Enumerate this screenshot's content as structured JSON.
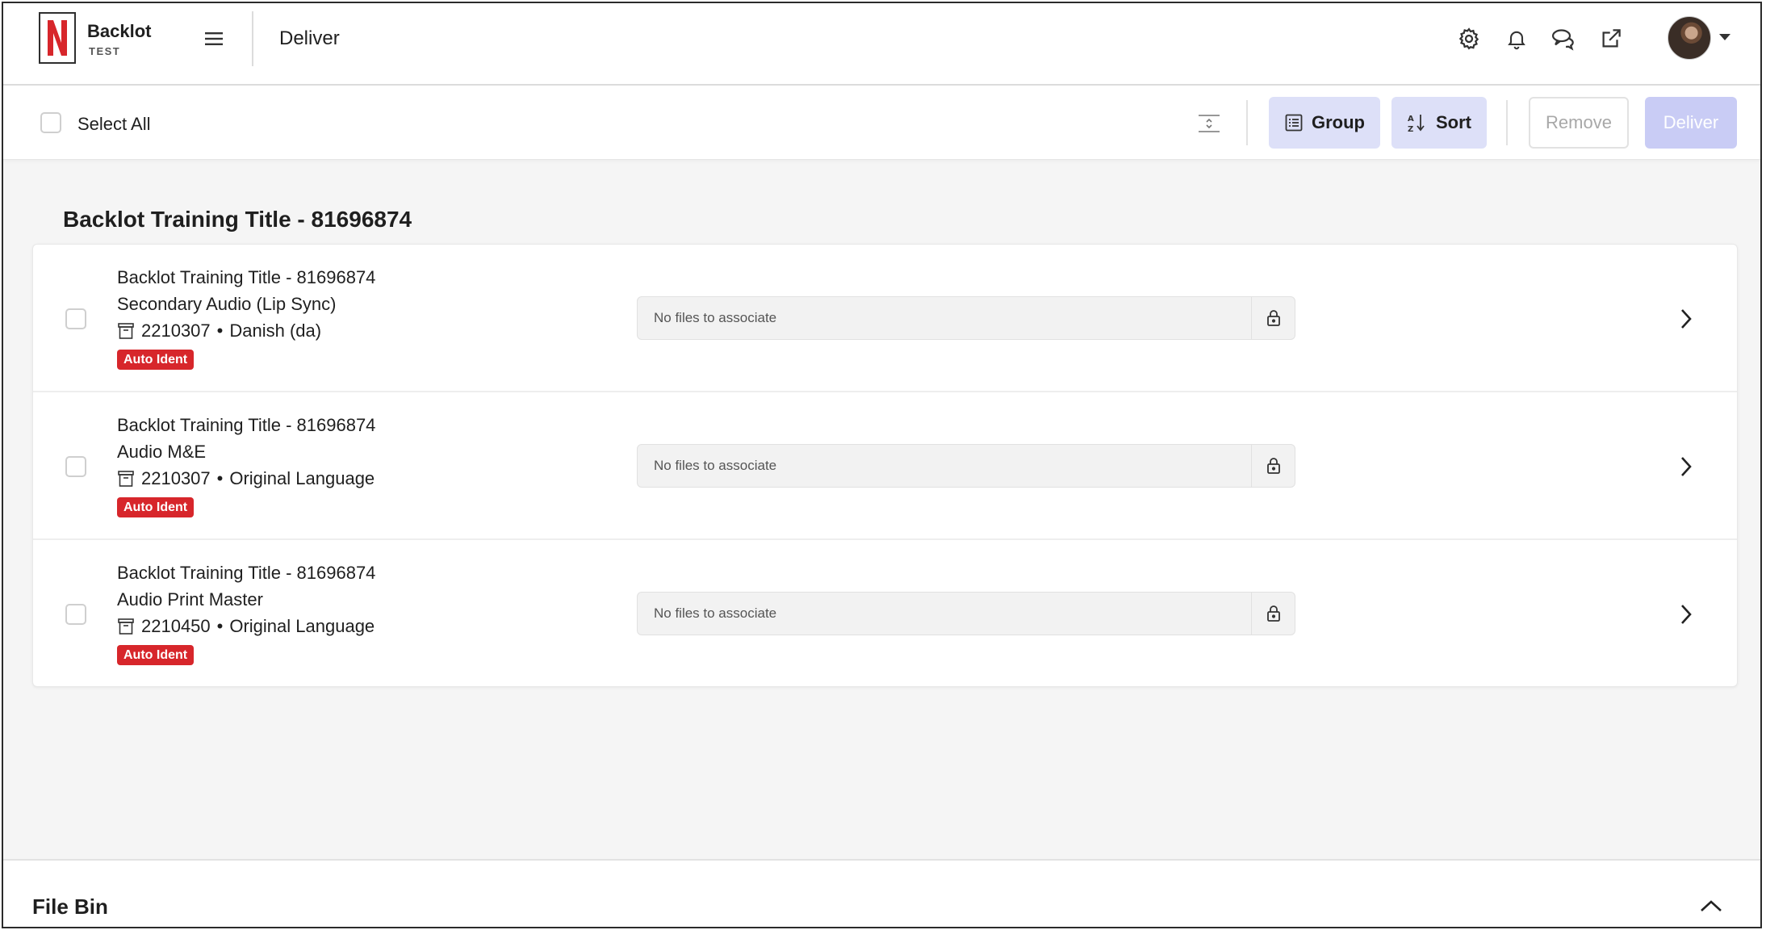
{
  "header": {
    "logo_letter": "N",
    "brand_name": "Backlot",
    "brand_env": "TEST",
    "page_title": "Deliver",
    "icons": [
      "settings-icon",
      "bell-icon",
      "chat-icon",
      "external-link-icon"
    ]
  },
  "toolbar": {
    "select_all_label": "Select All",
    "group_label": "Group",
    "sort_label": "Sort",
    "remove_label": "Remove",
    "deliver_label": "Deliver"
  },
  "group": {
    "title": "Backlot Training Title - 81696874",
    "rows": [
      {
        "title": "Backlot Training Title - 81696874",
        "subtitle": "Secondary Audio (Lip Sync)",
        "id": "2210307",
        "language": "Danish (da)",
        "badge": "Auto Ident",
        "files_placeholder": "No files to associate"
      },
      {
        "title": "Backlot Training Title - 81696874",
        "subtitle": "Audio M&E",
        "id": "2210307",
        "language": "Original Language",
        "badge": "Auto Ident",
        "files_placeholder": "No files to associate"
      },
      {
        "title": "Backlot Training Title - 81696874",
        "subtitle": "Audio Print Master",
        "id": "2210450",
        "language": "Original Language",
        "badge": "Auto Ident",
        "files_placeholder": "No files to associate"
      }
    ]
  },
  "separator": "•",
  "file_bin": {
    "title": "File Bin"
  },
  "colors": {
    "brand_red": "#d7262b",
    "soft_button": "#dde0f8",
    "primary_disabled": "#c9ccf5"
  }
}
